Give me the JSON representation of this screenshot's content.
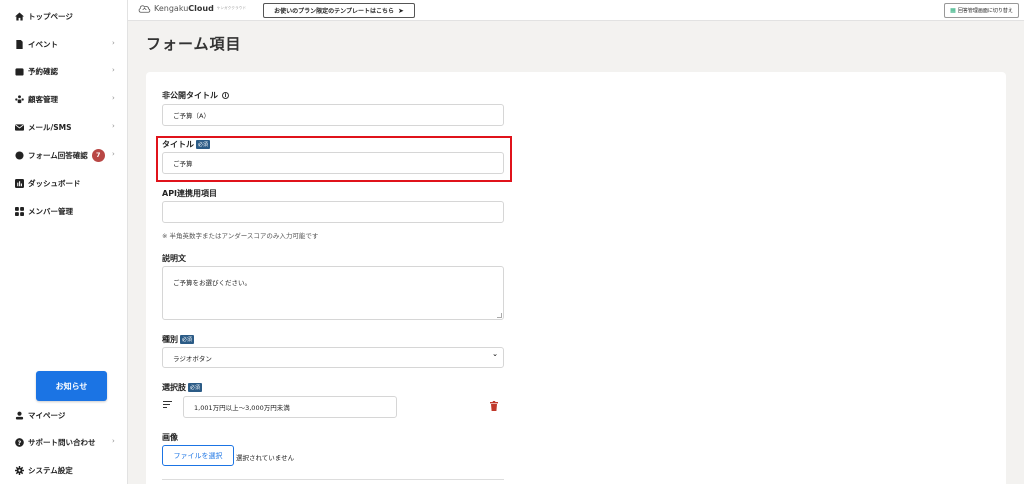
{
  "sidebar": {
    "items": [
      {
        "label": "トップページ",
        "icon": "home-icon",
        "chevron": ""
      },
      {
        "label": "イベント",
        "icon": "document-icon",
        "chevron": "›"
      },
      {
        "label": "予約確認",
        "icon": "calendar-icon",
        "chevron": "›"
      },
      {
        "label": "顧客管理",
        "icon": "people-icon",
        "chevron": "›"
      },
      {
        "label": "メール/SMS",
        "icon": "mail-icon",
        "chevron": "›"
      },
      {
        "label": "フォーム回答確認",
        "icon": "chat-icon",
        "chevron": "›",
        "badge": "7"
      },
      {
        "label": "ダッシュボード",
        "icon": "chart-icon",
        "chevron": ""
      },
      {
        "label": "メンバー管理",
        "icon": "grid-icon",
        "chevron": ""
      }
    ],
    "notice_button": "お知らせ",
    "bottom_items": [
      {
        "label": "マイページ",
        "icon": "user-icon",
        "chevron": ""
      },
      {
        "label": "サポート問い合わせ",
        "icon": "help-icon",
        "chevron": "›"
      },
      {
        "label": "システム設定",
        "icon": "gear-icon",
        "chevron": ""
      }
    ]
  },
  "topbar": {
    "logo_prefix": "Kengaku",
    "logo_bold": "Cloud",
    "logo_sub": "ケンガククラウド",
    "template_button": "お使いのプラン限定のテンプレートはこちら",
    "switch_button": "回答管理画面に切り替え"
  },
  "page": {
    "title": "フォーム項目"
  },
  "form": {
    "private_title_label": "非公開タイトル",
    "private_title_value": "ご予算（A）",
    "title_label": "タイトル",
    "required_badge": "必須",
    "title_value": "ご予算",
    "api_label": "API連携用項目",
    "api_value": "",
    "api_hint": "※ 半角英数字またはアンダースコアのみ入力可能です",
    "description_label": "説明文",
    "description_value": "ご予算をお選びください。",
    "type_label": "種別",
    "type_value": "ラジオボタン",
    "options_label": "選択肢",
    "option_value": "1,001万円以上～3,000万円未満",
    "image_label": "画像",
    "file_button": "ファイルを選択",
    "file_status": "選択されていません"
  },
  "colors": {
    "accent": "#1b74e4",
    "badge": "#b94745",
    "required": "#2b5b86",
    "highlight": "#e0131b",
    "trash": "#c0392b"
  }
}
